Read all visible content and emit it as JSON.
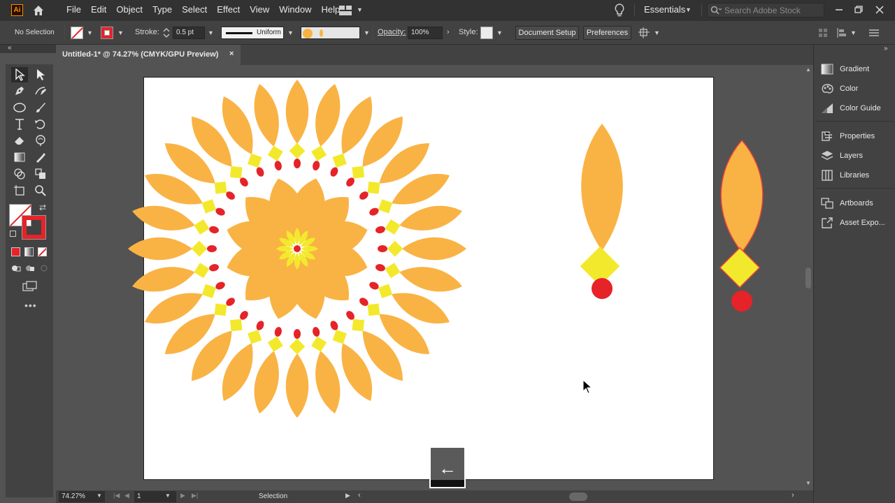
{
  "app": {
    "logo": "Ai",
    "menus": [
      "File",
      "Edit",
      "Object",
      "Type",
      "Select",
      "Effect",
      "View",
      "Window",
      "Help"
    ],
    "workspace": "Essentials",
    "search_placeholder": "Search Adobe Stock"
  },
  "control_bar": {
    "selection": "No Selection",
    "stroke_label": "Stroke:",
    "stroke_weight": "0.5 pt",
    "stroke_profile": "Uniform",
    "opacity_label": "Opacity:",
    "opacity_value": "100%",
    "style_label": "Style:",
    "document_setup": "Document Setup",
    "preferences": "Preferences"
  },
  "document_tab": {
    "title": "Untitled-1* @ 74.27% (CMYK/GPU Preview)",
    "close": "×"
  },
  "status_bar": {
    "zoom": "74.27%",
    "artboard_number": "1",
    "status": "Selection"
  },
  "right_panel": {
    "items": [
      {
        "label": "Gradient",
        "icon": "gradient-icon"
      },
      {
        "label": "Color",
        "icon": "color-icon"
      },
      {
        "label": "Color Guide",
        "icon": "color-guide-icon"
      },
      {
        "label": "Properties",
        "icon": "properties-icon"
      },
      {
        "label": "Layers",
        "icon": "layers-icon"
      },
      {
        "label": "Libraries",
        "icon": "libraries-icon"
      },
      {
        "label": "Artboards",
        "icon": "artboards-icon"
      },
      {
        "label": "Asset Expo...",
        "icon": "asset-export-icon"
      }
    ]
  },
  "overlay": {
    "back_arrow": "←"
  },
  "colors": {
    "petal": "#f9b344",
    "diamond": "#f3e92c",
    "dot": "#e52329",
    "outline": "#e8463a"
  }
}
